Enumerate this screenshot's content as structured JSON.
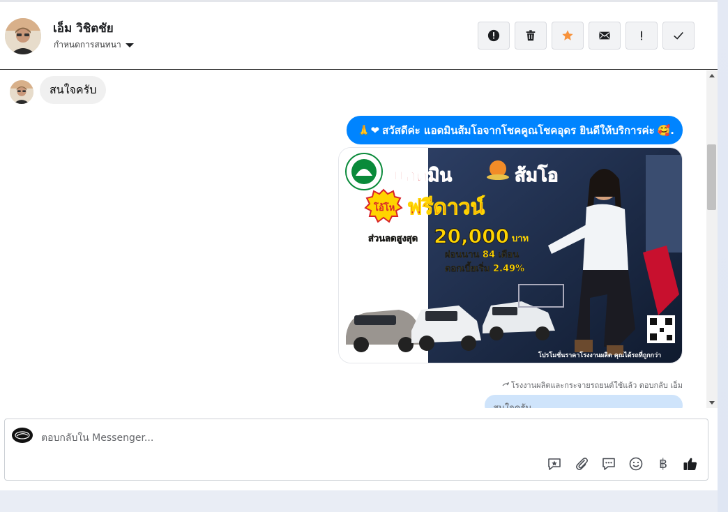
{
  "header": {
    "user_name": "เอ็ม วิชิตชัย",
    "subtitle": "กำหนดการสนทนา",
    "toolbar": [
      {
        "icon": "exclamation-circle-icon",
        "label": "spam"
      },
      {
        "icon": "trash-icon",
        "label": "delete"
      },
      {
        "icon": "star-icon",
        "label": "follow-up"
      },
      {
        "icon": "envelope-icon",
        "label": "mark-unread"
      },
      {
        "icon": "exclamation-icon",
        "label": "flag"
      },
      {
        "icon": "check-icon",
        "label": "done"
      }
    ]
  },
  "thread": {
    "incoming_text": "สนใจครับ",
    "outgoing_text": "สวัสดีค่ะ แอดมินส้มโอจากโชคคูณโชคอุดร ยินดีให้บริการค่ะ",
    "outgoing_prefix_emoji": "🙏❤",
    "outgoing_suffix_emoji": "🥰.",
    "promo": {
      "headline_left": "แอดมิน",
      "headline_right": "ส้มโอ",
      "badge": "โอ้โห",
      "offer": "ฟรีดาวน์",
      "discount_label": "ส่วนลดสูงสุด",
      "discount_amount": "20,000",
      "discount_unit": "บาท",
      "installment": "ผ่อนนาน 84 เดือน",
      "interest": "ดอกเบี้ยเริ่ม 2.49%",
      "footer": "โปรโมชั่นราคาโรงงานผลิต คุณได้รถที่ถูกกว่า",
      "brand_colors": {
        "headline": "#d8232a",
        "badge": "#ffd400",
        "bg": "#ffffff"
      }
    },
    "reply_meta": "โรงงานผลิตและกระจายรถยนต์ใช้แล้ว ตอบกลับ เอ็ม",
    "reply_quote": "สนใจครับ"
  },
  "composer": {
    "placeholder": "ตอบกลับใน Messenger...",
    "tools": [
      "saved-reply-icon",
      "paperclip-icon",
      "chat-bubble-icon",
      "smiley-icon",
      "baht-icon",
      "thumbs-up-icon"
    ],
    "baht_symbol": "฿"
  },
  "colors": {
    "accent": "#0084ff",
    "star": "#f7923b"
  }
}
